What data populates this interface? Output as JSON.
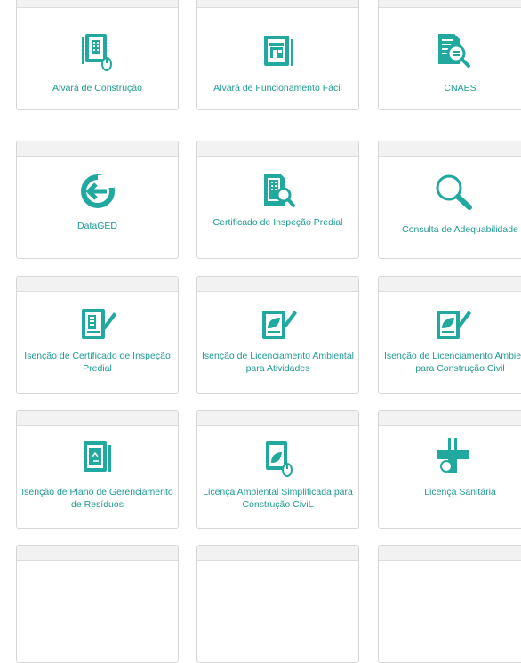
{
  "accent_color": "#21a89f",
  "services": [
    {
      "label": "Alvará de Construção",
      "icon": "building-document-icon"
    },
    {
      "label": "Alvará de Funcionamento Fácil",
      "icon": "storefront-document-icon"
    },
    {
      "label": "CNAES",
      "icon": "document-search-icon"
    },
    {
      "label": "DataGED",
      "icon": "dataged-logo-icon"
    },
    {
      "label": "Certificado de Inspeção Predial",
      "icon": "building-search-icon"
    },
    {
      "label": "Consulta de Adequabilidade",
      "icon": "magnifier-icon"
    },
    {
      "label": "Isenção de Certificado de Inspeção Predial",
      "icon": "building-pen-document-icon"
    },
    {
      "label": "Isenção de Licenciamento Ambiental para Atividades",
      "icon": "leaf-pen-document-icon"
    },
    {
      "label": "Isenção de Licenciamento Ambiental para Construção Civil",
      "icon": "leaf-pen-document-icon"
    },
    {
      "label": "Isenção de Plano de Gerenciamento de Resíduos",
      "icon": "recycle-bin-document-icon"
    },
    {
      "label": "Licença Ambiental Simplificada para Construção CiviL",
      "icon": "leaf-mouse-document-icon"
    },
    {
      "label": "Licença Sanitária",
      "icon": "health-cross-icon"
    }
  ]
}
